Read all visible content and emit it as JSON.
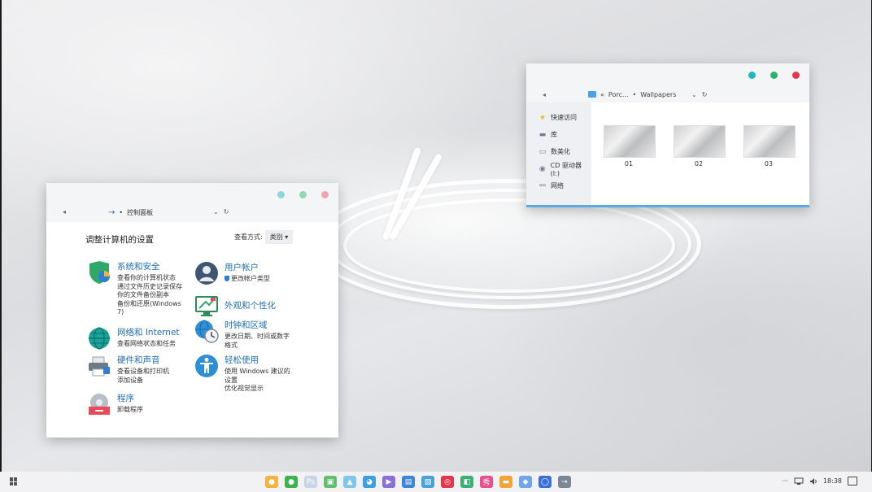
{
  "explorer": {
    "controls": [
      {
        "color": "#1fb5c1"
      },
      {
        "color": "#2cb36b"
      },
      {
        "color": "#e0394b"
      }
    ],
    "address": {
      "back": "◂",
      "crumb_sep": "«",
      "crumb_parent": "Porc...",
      "crumb_dot": "•",
      "crumb_current": "Wallpapers",
      "dropdown": "⌄",
      "refresh": "↻"
    },
    "sidebar": [
      {
        "icon": "star-icon",
        "glyph": "★",
        "label": "快速访问"
      },
      {
        "icon": "library-icon",
        "glyph": "▬",
        "label": "库"
      },
      {
        "icon": "monitor-icon",
        "glyph": "▭",
        "label": "数美化"
      },
      {
        "icon": "disc-icon",
        "glyph": "◉",
        "label": "CD 驱动器 (I:)"
      },
      {
        "icon": "network-icon",
        "glyph": "⚯",
        "label": "网络"
      }
    ],
    "files": [
      {
        "name": "01"
      },
      {
        "name": "02"
      },
      {
        "name": "03"
      }
    ]
  },
  "control_panel": {
    "controls": [
      {
        "color": "#8fd6dc"
      },
      {
        "color": "#8fd9b0"
      },
      {
        "color": "#f1a3ae"
      }
    ],
    "address": {
      "back": "◂",
      "arrow": "→",
      "dot": "•",
      "crumb": "控制面板",
      "dropdown": "⌄",
      "refresh": "↻"
    },
    "title": "调整计算机的设置",
    "view_label": "查看方式:",
    "view_value": "类别",
    "view_caret": "▾",
    "categories": {
      "security": {
        "title": "系统和安全",
        "links": [
          "查看你的计算机状态",
          "通过文件历史记录保存",
          "你的文件备份副本",
          "备份和还原(Windows",
          "7)"
        ]
      },
      "network": {
        "title": "网络和 Internet",
        "links": [
          "查看网络状态和任务"
        ]
      },
      "hardware": {
        "title": "硬件和声音",
        "links": [
          "查看设备和打印机",
          "添加设备"
        ]
      },
      "programs": {
        "title": "程序",
        "links": [
          "卸载程序"
        ]
      },
      "accounts": {
        "title": "用户帐户",
        "links": [
          "更改帐户类型"
        ]
      },
      "appearance": {
        "title": "外观和个性化",
        "links": []
      },
      "clock": {
        "title": "时钟和区域",
        "links": [
          "更改日期、时间或数字",
          "格式"
        ]
      },
      "ease": {
        "title": "轻松使用",
        "links": [
          "使用 Windows 建议的",
          "设置",
          "优化视觉显示"
        ]
      }
    }
  },
  "taskbar": {
    "apps": [
      {
        "name": "app-1",
        "color": "#f5b23c",
        "glyph": "●"
      },
      {
        "name": "wechat",
        "color": "#3cb34a",
        "glyph": "●"
      },
      {
        "name": "app-3",
        "color": "#c9d6e8",
        "glyph": "Ps"
      },
      {
        "name": "app-4",
        "color": "#5fbf6f",
        "glyph": "▣"
      },
      {
        "name": "app-5",
        "color": "#7fc7e8",
        "glyph": "▲"
      },
      {
        "name": "app-6",
        "color": "#3aa0e0",
        "glyph": "◕"
      },
      {
        "name": "app-7",
        "color": "#8a6fd6",
        "glyph": "▶"
      },
      {
        "name": "app-8",
        "color": "#3b87d6",
        "glyph": "▤"
      },
      {
        "name": "app-9",
        "color": "#4aa3d8",
        "glyph": "▧"
      },
      {
        "name": "app-10",
        "color": "#e0394b",
        "glyph": "◎"
      },
      {
        "name": "app-11",
        "color": "#3dae74",
        "glyph": "◧"
      },
      {
        "name": "app-12",
        "color": "#e94f8c",
        "glyph": "秀"
      },
      {
        "name": "file-explorer",
        "color": "#f0a43a",
        "glyph": "▬"
      },
      {
        "name": "app-14",
        "color": "#6fa6e8",
        "glyph": "◆"
      },
      {
        "name": "app-15",
        "color": "#3b6fd6",
        "glyph": "◯"
      },
      {
        "name": "app-16",
        "color": "#7b8794",
        "glyph": "→"
      }
    ],
    "tray": {
      "overflow": "···",
      "clock": "18:38"
    }
  }
}
